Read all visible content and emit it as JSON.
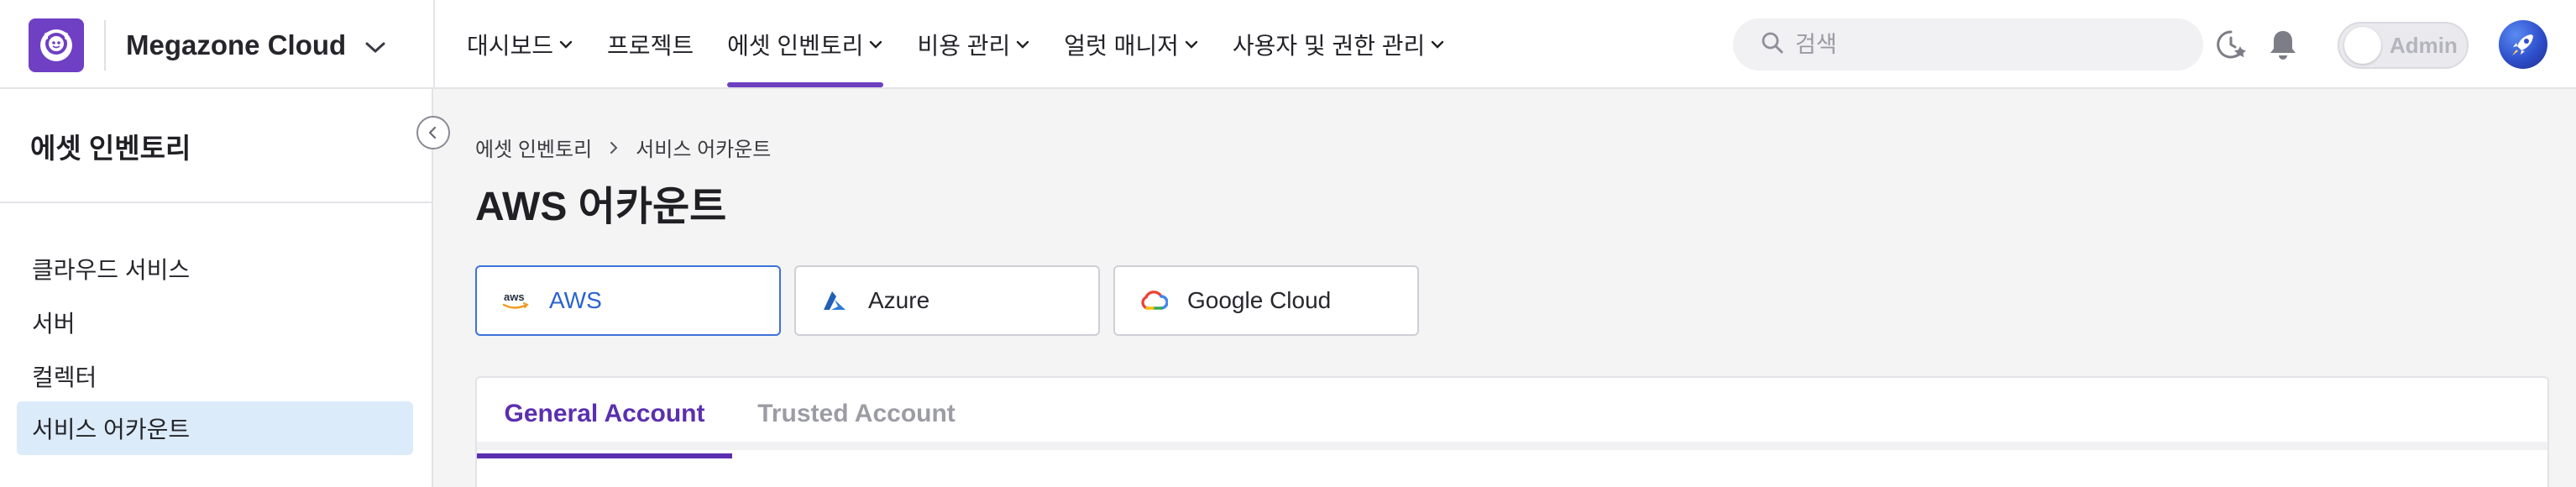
{
  "brand": {
    "workspace_name": "Megazone Cloud",
    "accent": "#6d3fc0"
  },
  "nav": {
    "menu": [
      {
        "label": "대시보드",
        "has_dropdown": true
      },
      {
        "label": "프로젝트",
        "has_dropdown": false
      },
      {
        "label": "에셋 인벤토리",
        "has_dropdown": true,
        "active": true
      },
      {
        "label": "비용 관리",
        "has_dropdown": true
      },
      {
        "label": "얼럿 매니저",
        "has_dropdown": true
      },
      {
        "label": "사용자 및 권한 관리",
        "has_dropdown": true
      }
    ],
    "search_placeholder": "검색",
    "role_toggle_label": "Admin",
    "icons": [
      "search-icon",
      "recent-favorites-icon",
      "bell-icon",
      "avatar"
    ]
  },
  "sidebar": {
    "title": "에셋 인벤토리",
    "items": [
      {
        "label": "클라우드 서비스",
        "selected": false
      },
      {
        "label": "서버",
        "selected": false
      },
      {
        "label": "컬렉터",
        "selected": false
      },
      {
        "label": "서비스 어카운트",
        "selected": true
      }
    ]
  },
  "breadcrumb": [
    "에셋 인벤토리",
    "서비스 어카운트"
  ],
  "page_title": "AWS 어카운트",
  "providers": [
    {
      "label": "AWS",
      "icon": "aws-logo-icon",
      "active": true
    },
    {
      "label": "Azure",
      "icon": "azure-logo-icon",
      "active": false
    },
    {
      "label": "Google Cloud",
      "icon": "google-cloud-logo-icon",
      "active": false
    }
  ],
  "tabs": [
    {
      "label": "General Account",
      "active": true
    },
    {
      "label": "Trusted Account",
      "active": false
    }
  ]
}
